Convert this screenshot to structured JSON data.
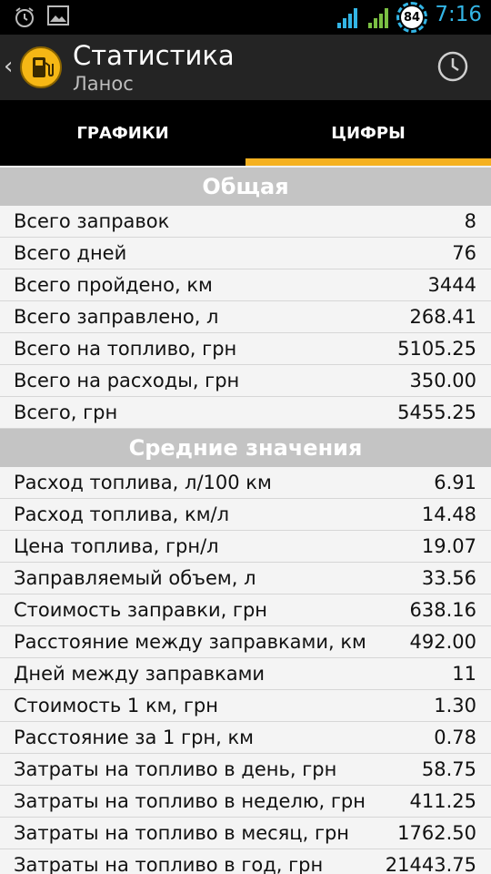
{
  "status_bar": {
    "time": "7:16",
    "battery": "84",
    "icons": [
      "alarm-clock-icon",
      "image-icon",
      "signal-icon",
      "signal-icon"
    ],
    "accent_color": "#33b5e5"
  },
  "action_bar": {
    "title": "Статистика",
    "subtitle": "Ланос",
    "back_icon": "chevron-left-icon",
    "app_icon": "fuel-pump-icon",
    "action_icon": "history-clock-icon"
  },
  "tabs": [
    {
      "label": "ГРАФИКИ",
      "active": false
    },
    {
      "label": "ЦИФРЫ",
      "active": true
    }
  ],
  "accent_color": "#f5b120",
  "sections": [
    {
      "title": "Общая",
      "rows": [
        {
          "label": "Всего заправок",
          "value": "8"
        },
        {
          "label": "Всего дней",
          "value": "76"
        },
        {
          "label": "Всего пройдено, км",
          "value": "3444"
        },
        {
          "label": "Всего заправлено, л",
          "value": "268.41"
        },
        {
          "label": "Всего на топливо, грн",
          "value": "5105.25"
        },
        {
          "label": "Всего на расходы, грн",
          "value": "350.00"
        },
        {
          "label": "Всего, грн",
          "value": "5455.25"
        }
      ]
    },
    {
      "title": "Средние значения",
      "rows": [
        {
          "label": "Расход топлива, л/100 км",
          "value": "6.91"
        },
        {
          "label": "Расход топлива, км/л",
          "value": "14.48"
        },
        {
          "label": "Цена топлива, грн/л",
          "value": "19.07"
        },
        {
          "label": "Заправляемый объем, л",
          "value": "33.56"
        },
        {
          "label": "Стоимость заправки, грн",
          "value": "638.16"
        },
        {
          "label": "Расстояние между заправками, км",
          "value": "492.00"
        },
        {
          "label": "Дней между заправками",
          "value": "11"
        },
        {
          "label": "Стоимость 1 км, грн",
          "value": "1.30"
        },
        {
          "label": "Расстояние за 1 грн, км",
          "value": "0.78"
        },
        {
          "label": "Затраты на топливо в день, грн",
          "value": "58.75"
        },
        {
          "label": "Затраты на топливо в неделю, грн",
          "value": "411.25"
        },
        {
          "label": "Затраты на топливо в месяц, грн",
          "value": "1762.50"
        },
        {
          "label": "Затраты на топливо в год, грн",
          "value": "21443.75"
        }
      ]
    }
  ]
}
